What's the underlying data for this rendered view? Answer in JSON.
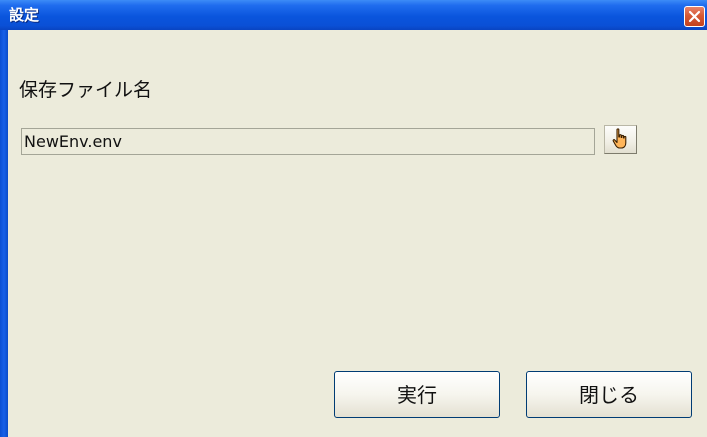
{
  "window": {
    "title": "設定",
    "close_icon": "close-icon"
  },
  "form": {
    "label": "保存ファイル名",
    "filename_value": "NewEnv.env",
    "browse_icon": "hand-pointer-icon"
  },
  "buttons": {
    "run_label": "実行",
    "close_label": "閉じる"
  },
  "colors": {
    "titlebar": "#0a55dd",
    "client_background": "#ecebdb",
    "close_button": "#d65a36"
  }
}
